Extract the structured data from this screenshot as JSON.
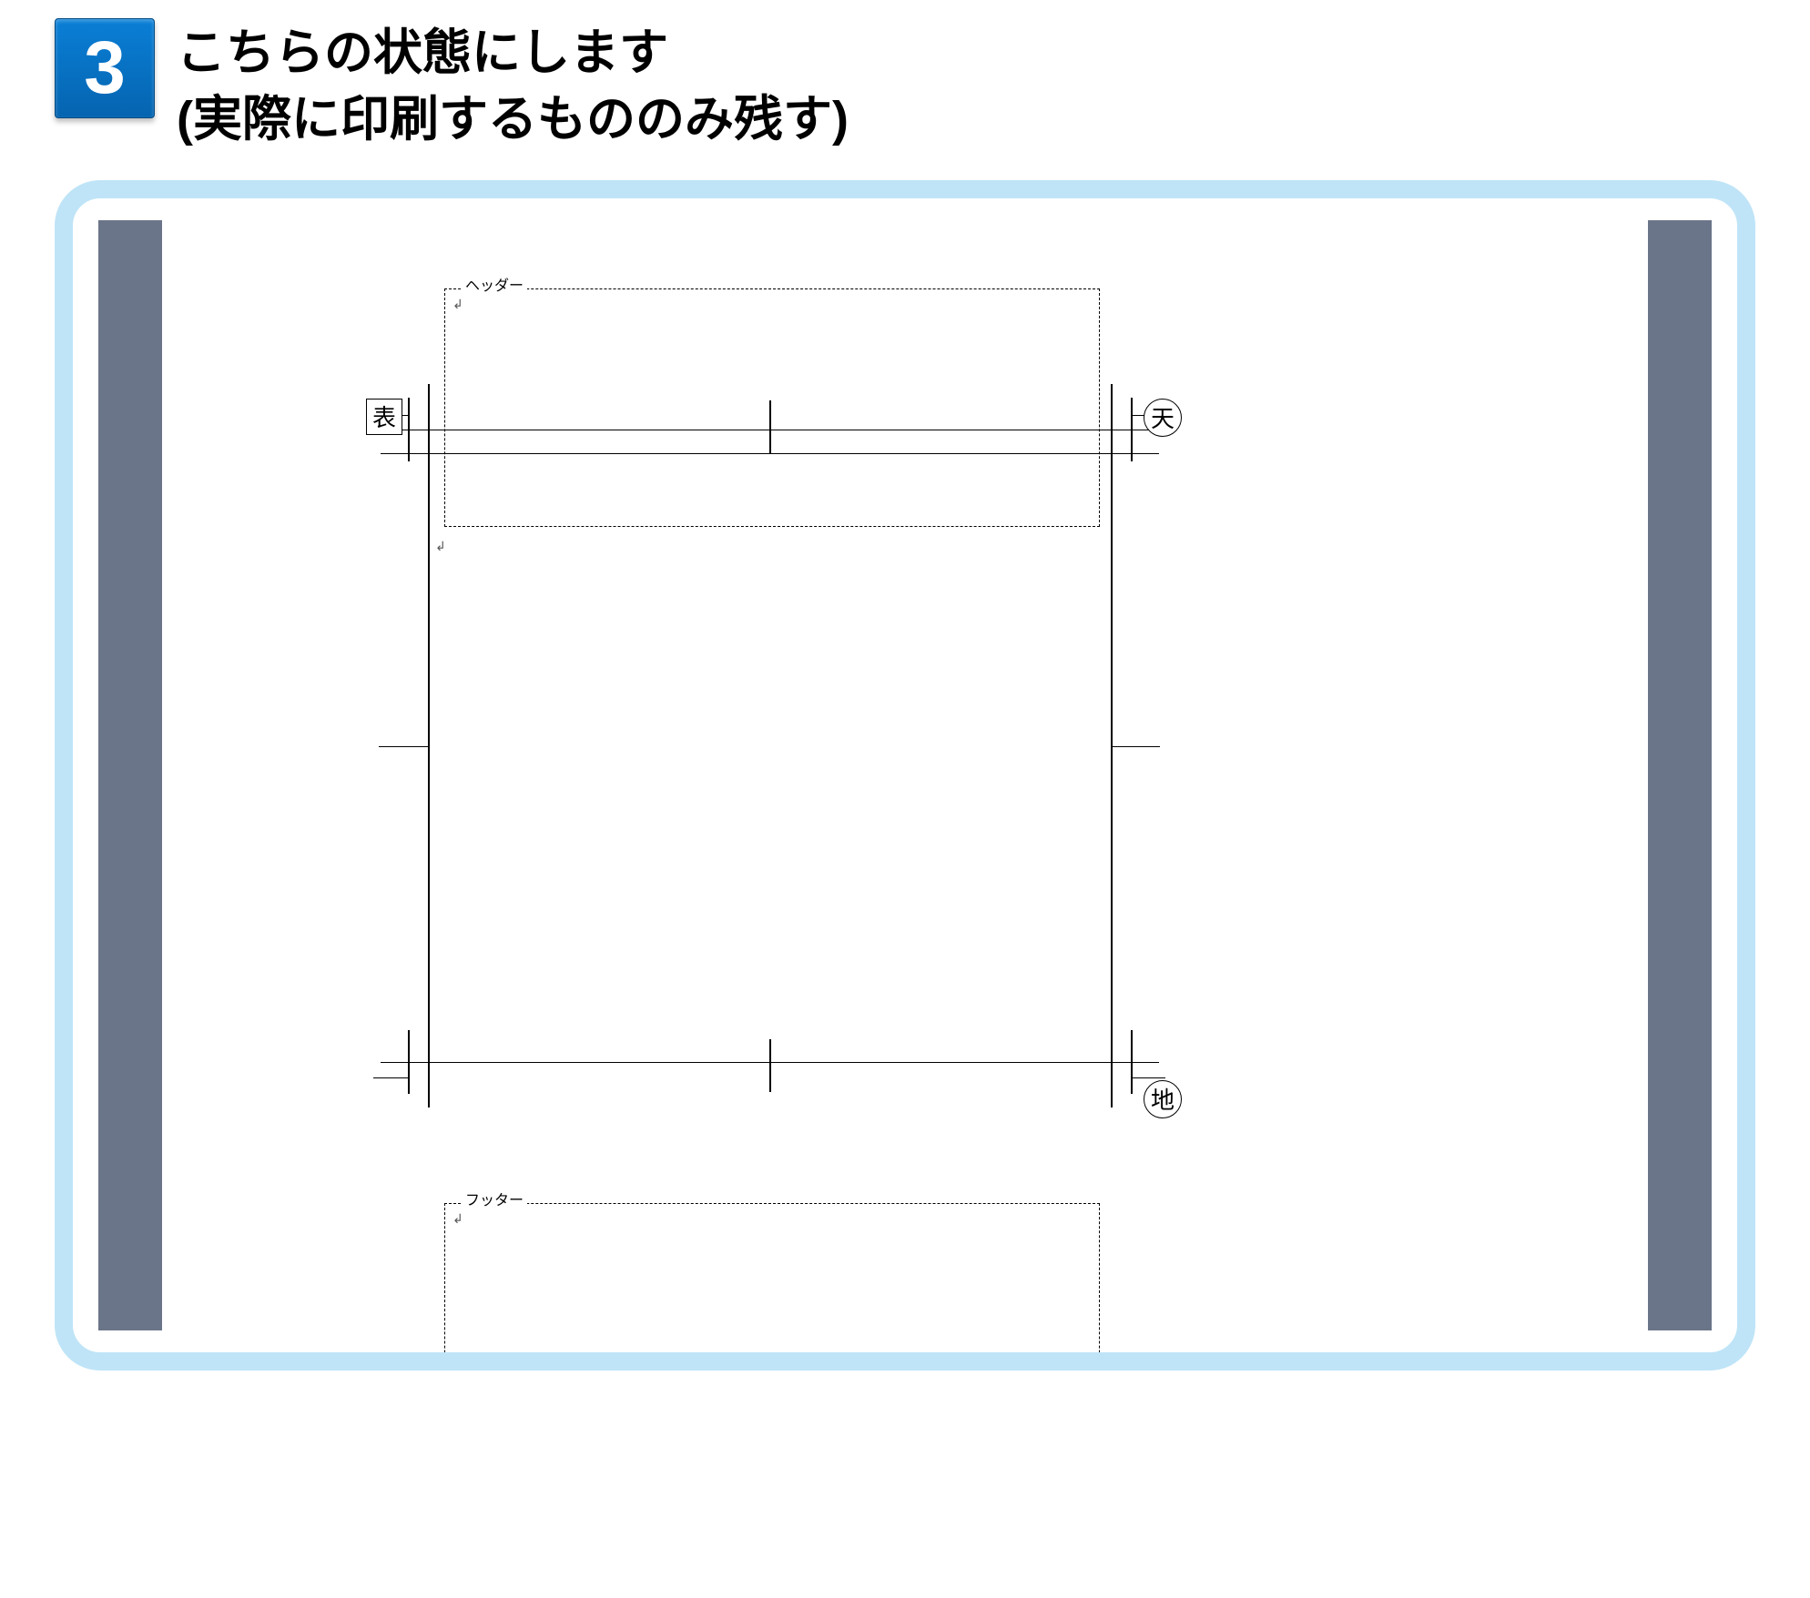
{
  "step": {
    "number": "3",
    "title_line1": "こちらの状態にします",
    "title_line2": "(実際に印刷するもののみ残す)"
  },
  "layout": {
    "header_label": "ヘッダー",
    "footer_label": "フッター",
    "mark_omote": "表",
    "mark_ten": "天",
    "mark_chi": "地",
    "paragraph_mark": "↲"
  }
}
